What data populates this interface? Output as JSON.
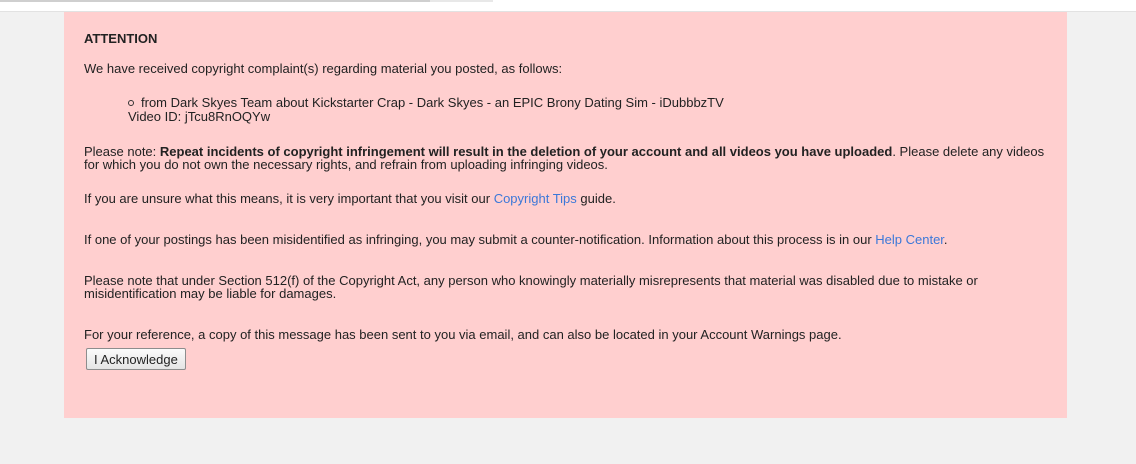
{
  "notice": {
    "heading": "ATTENTION",
    "intro": "We have received copyright complaint(s) regarding material you posted, as follows:",
    "complaints": [
      {
        "text": "from Dark Skyes Team about Kickstarter Crap - Dark Skyes - an EPIC Brony Dating Sim - iDubbbzTV",
        "video_id": "Video ID: jTcu8RnOQYw"
      }
    ],
    "note_prefix": "Please note: ",
    "note_bold": "Repeat incidents of copyright infringement will result in the deletion of your account and all videos you have uploaded",
    "note_suffix": ". Please delete any videos for which you do not own the necessary rights, and refrain from uploading infringing videos.",
    "tips_prefix": "If you are unsure what this means, it is very important that you visit our ",
    "tips_link": "Copyright Tips",
    "tips_suffix": " guide.",
    "counter_prefix": "If one of your postings has been misidentified as infringing, you may submit a counter-notification. Information about this process is in our ",
    "counter_link": "Help Center",
    "counter_suffix": ".",
    "section_512": "Please note that under Section 512(f) of the Copyright Act, any person who knowingly materially misrepresents that material was disabled due to mistake or misidentification may be liable for damages.",
    "reference": "For your reference, a copy of this message has been sent to you via email, and can also be located in your Account Warnings page.",
    "acknowledge_label": "I Acknowledge"
  },
  "colors": {
    "notice_bg": "#ffcfcf",
    "page_bg": "#f1f1f1",
    "link": "#3c78d8"
  }
}
